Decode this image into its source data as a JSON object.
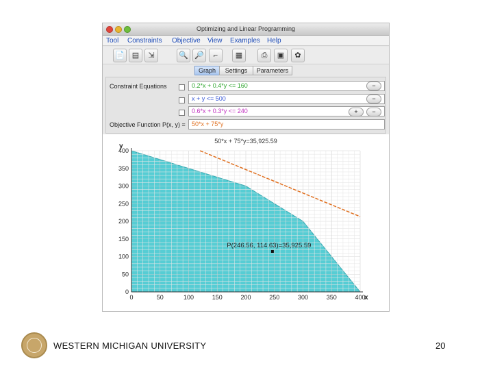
{
  "window": {
    "title": "Optimizing and Linear Programming"
  },
  "menu": [
    "Tool",
    "Constraints",
    "Objective",
    "View",
    "Examples",
    "Help"
  ],
  "toolbar_icons": [
    "open-file-icon",
    "save-file-icon",
    "export-icon",
    "zoom-in-icon",
    "zoom-out-icon",
    "pan-icon",
    "grid-icon",
    "print-icon",
    "print-preview-icon",
    "settings-icon"
  ],
  "tabs": [
    "Graph",
    "Settings",
    "Parameters"
  ],
  "active_tab": "Graph",
  "constraints": {
    "label": "Constraint Equations",
    "items": [
      {
        "text": "0.2*x + 0.4*y <= 160",
        "color": "#2fa62f"
      },
      {
        "text": "x + y <= 500",
        "color": "#3b5ad6"
      },
      {
        "text": "0.6*x + 0.3*y <= 240",
        "color": "#c02fbf"
      }
    ],
    "minus_label": "−",
    "plus_label": "+"
  },
  "objective": {
    "label": "Objective Function P(x, y) =",
    "value": "50*x + 75*y",
    "color": "#e07020"
  },
  "graph": {
    "header": "50*x + 75*y=35,925.59",
    "point_label": "P(246.56, 114.63)=35,925.59",
    "x_axis_letter": "x",
    "y_axis_letter": "y"
  },
  "chart_data": {
    "type": "area",
    "feasible_region_vertices": [
      [
        0,
        400
      ],
      [
        200,
        300
      ],
      [
        300,
        200
      ],
      [
        400,
        0
      ],
      [
        0,
        0
      ]
    ],
    "objective_line": [
      [
        120,
        400
      ],
      [
        400,
        213.33
      ]
    ],
    "optimal_point": [
      246.56,
      114.63
    ],
    "xlim": [
      0,
      400
    ],
    "ylim": [
      0,
      400
    ],
    "x_ticks": [
      0,
      50,
      100,
      150,
      200,
      250,
      300,
      350,
      400
    ],
    "y_ticks": [
      0,
      50,
      100,
      150,
      200,
      250,
      300,
      350,
      400
    ],
    "fill_color": "#56cdd4",
    "line_color": "#e07020",
    "grid": true
  },
  "footer": {
    "university": "WESTERN MICHIGAN UNIVERSITY",
    "page": "20"
  }
}
